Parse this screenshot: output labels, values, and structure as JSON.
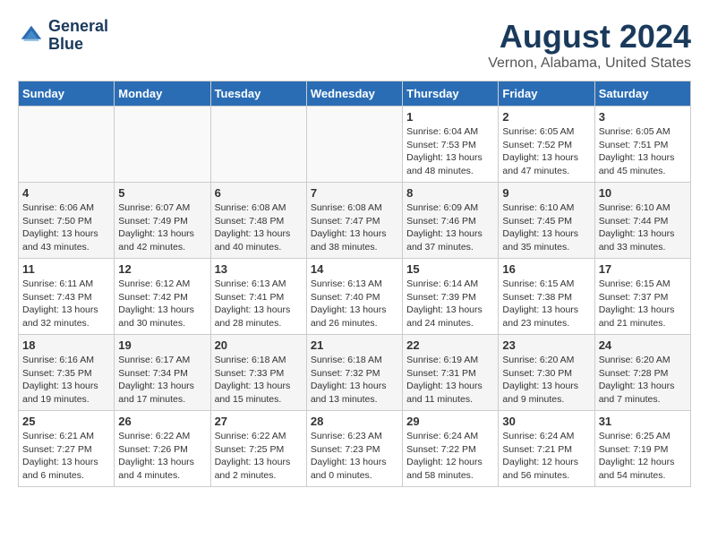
{
  "header": {
    "logo_line1": "General",
    "logo_line2": "Blue",
    "month_year": "August 2024",
    "location": "Vernon, Alabama, United States"
  },
  "days_of_week": [
    "Sunday",
    "Monday",
    "Tuesday",
    "Wednesday",
    "Thursday",
    "Friday",
    "Saturday"
  ],
  "weeks": [
    [
      {
        "day": "",
        "info": ""
      },
      {
        "day": "",
        "info": ""
      },
      {
        "day": "",
        "info": ""
      },
      {
        "day": "",
        "info": ""
      },
      {
        "day": "1",
        "info": "Sunrise: 6:04 AM\nSunset: 7:53 PM\nDaylight: 13 hours\nand 48 minutes."
      },
      {
        "day": "2",
        "info": "Sunrise: 6:05 AM\nSunset: 7:52 PM\nDaylight: 13 hours\nand 47 minutes."
      },
      {
        "day": "3",
        "info": "Sunrise: 6:05 AM\nSunset: 7:51 PM\nDaylight: 13 hours\nand 45 minutes."
      }
    ],
    [
      {
        "day": "4",
        "info": "Sunrise: 6:06 AM\nSunset: 7:50 PM\nDaylight: 13 hours\nand 43 minutes."
      },
      {
        "day": "5",
        "info": "Sunrise: 6:07 AM\nSunset: 7:49 PM\nDaylight: 13 hours\nand 42 minutes."
      },
      {
        "day": "6",
        "info": "Sunrise: 6:08 AM\nSunset: 7:48 PM\nDaylight: 13 hours\nand 40 minutes."
      },
      {
        "day": "7",
        "info": "Sunrise: 6:08 AM\nSunset: 7:47 PM\nDaylight: 13 hours\nand 38 minutes."
      },
      {
        "day": "8",
        "info": "Sunrise: 6:09 AM\nSunset: 7:46 PM\nDaylight: 13 hours\nand 37 minutes."
      },
      {
        "day": "9",
        "info": "Sunrise: 6:10 AM\nSunset: 7:45 PM\nDaylight: 13 hours\nand 35 minutes."
      },
      {
        "day": "10",
        "info": "Sunrise: 6:10 AM\nSunset: 7:44 PM\nDaylight: 13 hours\nand 33 minutes."
      }
    ],
    [
      {
        "day": "11",
        "info": "Sunrise: 6:11 AM\nSunset: 7:43 PM\nDaylight: 13 hours\nand 32 minutes."
      },
      {
        "day": "12",
        "info": "Sunrise: 6:12 AM\nSunset: 7:42 PM\nDaylight: 13 hours\nand 30 minutes."
      },
      {
        "day": "13",
        "info": "Sunrise: 6:13 AM\nSunset: 7:41 PM\nDaylight: 13 hours\nand 28 minutes."
      },
      {
        "day": "14",
        "info": "Sunrise: 6:13 AM\nSunset: 7:40 PM\nDaylight: 13 hours\nand 26 minutes."
      },
      {
        "day": "15",
        "info": "Sunrise: 6:14 AM\nSunset: 7:39 PM\nDaylight: 13 hours\nand 24 minutes."
      },
      {
        "day": "16",
        "info": "Sunrise: 6:15 AM\nSunset: 7:38 PM\nDaylight: 13 hours\nand 23 minutes."
      },
      {
        "day": "17",
        "info": "Sunrise: 6:15 AM\nSunset: 7:37 PM\nDaylight: 13 hours\nand 21 minutes."
      }
    ],
    [
      {
        "day": "18",
        "info": "Sunrise: 6:16 AM\nSunset: 7:35 PM\nDaylight: 13 hours\nand 19 minutes."
      },
      {
        "day": "19",
        "info": "Sunrise: 6:17 AM\nSunset: 7:34 PM\nDaylight: 13 hours\nand 17 minutes."
      },
      {
        "day": "20",
        "info": "Sunrise: 6:18 AM\nSunset: 7:33 PM\nDaylight: 13 hours\nand 15 minutes."
      },
      {
        "day": "21",
        "info": "Sunrise: 6:18 AM\nSunset: 7:32 PM\nDaylight: 13 hours\nand 13 minutes."
      },
      {
        "day": "22",
        "info": "Sunrise: 6:19 AM\nSunset: 7:31 PM\nDaylight: 13 hours\nand 11 minutes."
      },
      {
        "day": "23",
        "info": "Sunrise: 6:20 AM\nSunset: 7:30 PM\nDaylight: 13 hours\nand 9 minutes."
      },
      {
        "day": "24",
        "info": "Sunrise: 6:20 AM\nSunset: 7:28 PM\nDaylight: 13 hours\nand 7 minutes."
      }
    ],
    [
      {
        "day": "25",
        "info": "Sunrise: 6:21 AM\nSunset: 7:27 PM\nDaylight: 13 hours\nand 6 minutes."
      },
      {
        "day": "26",
        "info": "Sunrise: 6:22 AM\nSunset: 7:26 PM\nDaylight: 13 hours\nand 4 minutes."
      },
      {
        "day": "27",
        "info": "Sunrise: 6:22 AM\nSunset: 7:25 PM\nDaylight: 13 hours\nand 2 minutes."
      },
      {
        "day": "28",
        "info": "Sunrise: 6:23 AM\nSunset: 7:23 PM\nDaylight: 13 hours\nand 0 minutes."
      },
      {
        "day": "29",
        "info": "Sunrise: 6:24 AM\nSunset: 7:22 PM\nDaylight: 12 hours\nand 58 minutes."
      },
      {
        "day": "30",
        "info": "Sunrise: 6:24 AM\nSunset: 7:21 PM\nDaylight: 12 hours\nand 56 minutes."
      },
      {
        "day": "31",
        "info": "Sunrise: 6:25 AM\nSunset: 7:19 PM\nDaylight: 12 hours\nand 54 minutes."
      }
    ]
  ]
}
